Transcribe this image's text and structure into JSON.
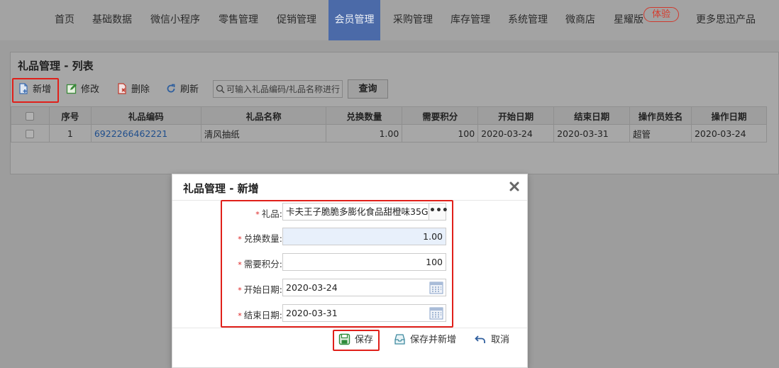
{
  "nav": {
    "items": [
      "首页",
      "基础数据",
      "微信小程序",
      "零售管理",
      "促销管理",
      "会员管理",
      "采购管理",
      "库存管理",
      "系统管理",
      "微商店",
      "星耀版",
      "更多思迅产品"
    ],
    "active": "会员管理",
    "badge": "体验"
  },
  "panel": {
    "title": "礼品管理 - 列表",
    "toolbar": {
      "add": "新增",
      "edit": "修改",
      "delete": "删除",
      "refresh": "刷新",
      "search_placeholder": "可输入礼品编码/礼品名称进行",
      "query": "查询"
    },
    "columns": [
      "序号",
      "礼品编码",
      "礼品名称",
      "兑换数量",
      "需要积分",
      "开始日期",
      "结束日期",
      "操作员姓名",
      "操作日期"
    ],
    "rows": [
      {
        "seq": "1",
        "code": "6922266462221",
        "name": "清风抽纸",
        "qty": "1.00",
        "points": "100",
        "start": "2020-03-24",
        "end": "2020-03-31",
        "operator": "超管",
        "op_date": "2020-03-24"
      }
    ]
  },
  "modal": {
    "title": "礼品管理 - 新增",
    "fields": {
      "gift_label": "礼品:",
      "gift_value": "卡夫王子脆脆多膨化食品甜橙味35G",
      "qty_label": "兑换数量:",
      "qty_value": "1.00",
      "points_label": "需要积分:",
      "points_value": "100",
      "start_label": "开始日期:",
      "start_value": "2020-03-24",
      "end_label": "结束日期:",
      "end_value": "2020-03-31"
    },
    "buttons": {
      "save": "保存",
      "save_new": "保存并新增",
      "cancel": "取消"
    },
    "dots": "•••"
  },
  "colors": {
    "accent": "#4b6aa8",
    "highlight": "#e0201a",
    "link": "#1f4e8c"
  }
}
